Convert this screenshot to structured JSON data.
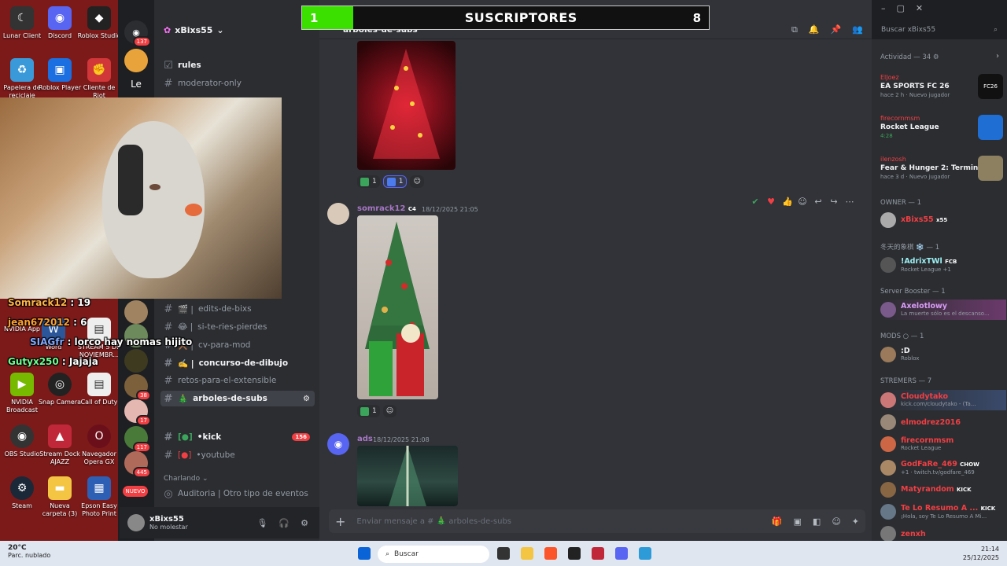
{
  "desktop": {
    "icons": [
      "Lunar Client",
      "Discord",
      "Roblox Studio",
      "Papelera de reciclaje",
      "Roblox Player",
      "Cliente de Riot",
      "Games",
      "Word",
      "STREAM 5 DE NOVIEMBR...",
      "NVIDIA App",
      "NVIDIA Broadcast",
      "Snap Camera",
      "Call of Duty",
      "OBS Studio",
      "Stream Dock AJAZZ",
      "Navegador Opera GX",
      "Steam",
      "Nueva carpeta (3)",
      "Epson Easy Photo Print"
    ]
  },
  "subs_bar": {
    "current": "1",
    "label": "SUSCRIPTORES",
    "goal": "8",
    "progress": 0.125,
    "fill_color": "#3be000"
  },
  "overlay_chat": [
    {
      "user": "Somrack12",
      "text": "19",
      "color": "#ffb347"
    },
    {
      "user": "jean672012",
      "text": "6",
      "color": "#ff9f2e"
    },
    {
      "user": "SIAGfr",
      "text": "lorco hay nomas hijito",
      "color": "#7fa8ff"
    },
    {
      "user": "Gutyx250",
      "text": "Jajaja",
      "color": "#6cff8f"
    }
  ],
  "servers": {
    "badges": [
      "137",
      "51",
      "38",
      "17",
      "117",
      "445",
      "NUEVO"
    ],
    "letter": "Le"
  },
  "guild": {
    "name": "xBixs55",
    "channels_top": [
      {
        "name": "rules",
        "bright": true
      },
      {
        "name": "moderator-only",
        "bright": false
      }
    ],
    "channels": [
      {
        "name": "edits-de-bixs",
        "emoji": "🎬 |",
        "bright": false
      },
      {
        "name": "si-te-ries-pierdes",
        "emoji": "😂 |",
        "bright": false
      },
      {
        "name": "cv-para-mod",
        "emoji": "⚒️ |",
        "bright": false
      },
      {
        "name": "concurso-de-dibujo",
        "emoji": "✍️ |",
        "bright": true
      },
      {
        "name": "retos-para-el-extensible",
        "emoji": "",
        "bright": false
      },
      {
        "name": "arboles-de-subs",
        "emoji": "🎄",
        "bright": true,
        "active": true
      }
    ],
    "kick_channel": {
      "name": "•kick",
      "count": "156"
    },
    "youtube_channel": {
      "name": "•youtube"
    },
    "category": "Charlando",
    "voice_channel": "Auditoria | Otro tipo de eventos"
  },
  "user": {
    "name": "xBixs55",
    "status": "No molestar"
  },
  "main": {
    "channel_title": "arboles-de-subs",
    "search_placeholder": "Buscar xBixs55",
    "reactions_1": [
      {
        "count": "1",
        "color": "#3ba55c"
      },
      {
        "count": "1",
        "color": "#4b7bec"
      }
    ],
    "message2": {
      "author": "somrack12",
      "tag": "C4",
      "time": "18/12/2025 21:05",
      "color": "#a676c4"
    },
    "reactions_2": [
      {
        "count": "1",
        "color": "#3ba55c"
      }
    ],
    "message3": {
      "author": "ads",
      "time": "18/12/2025 21:08",
      "color": "#a676c4"
    },
    "composer_placeholder": "Enviar mensaje a # 🎄 arboles-de-subs"
  },
  "members": {
    "activity_header": "Actividad — 34",
    "activities": [
      {
        "user": "ElJoez",
        "game": "EA SPORTS FC 26",
        "time": "hace 2 h",
        "extra": "Nuevo jugador",
        "thumb_color": "#111"
      },
      {
        "user": "firecornmsm",
        "game": "Rocket League",
        "time": "4:28",
        "extra": "",
        "thumb_color": "#1f6ed4"
      },
      {
        "user": "ilenzosh",
        "game": "Fear & Hunger 2: Termina",
        "time": "hace 3 d",
        "extra": "Nuevo jugador",
        "thumb_color": "#8c8060"
      }
    ],
    "sections": [
      {
        "title": "OWNER — 1",
        "members": [
          {
            "name": "xBixs55",
            "sub": "",
            "tag": "x55",
            "color": "#f23f43"
          }
        ]
      },
      {
        "title": "冬天的象棋 ❄️ — 1",
        "members": [
          {
            "name": "!AdrixTWl",
            "sub": "Rocket League +1",
            "tag": "FCB",
            "color": "#9cf0f4"
          }
        ]
      },
      {
        "title": "Server Booster — 1",
        "members": [
          {
            "name": "Axelotlowy",
            "sub": "La muerte sólo es el descanso...",
            "tag": "",
            "color": "#d89cf6"
          }
        ]
      },
      {
        "title": "MODS ○ — 1",
        "members": [
          {
            "name": ":D",
            "sub": "Roblox",
            "tag": "",
            "color": "#f2f3f5"
          }
        ]
      },
      {
        "title": "STREMERS — 7",
        "members": [
          {
            "name": "Cloudytako",
            "sub": "kick.com/cloudytako - (Ta...",
            "tag": "",
            "color": "#f23f43"
          },
          {
            "name": "elmodrez2016",
            "sub": "",
            "tag": "",
            "color": "#f23f43"
          },
          {
            "name": "firecornmsm",
            "sub": "Rocket League",
            "tag": "",
            "color": "#f23f43"
          },
          {
            "name": "GodFaRe_469",
            "sub": "+1 · twitch.tv/godfare_469",
            "tag": "CHOW",
            "color": "#f23f43"
          },
          {
            "name": "Matyrandom",
            "sub": "",
            "tag": "KICK",
            "color": "#f23f43"
          },
          {
            "name": "Te Lo Resumo A ...",
            "sub": "¡Hola, soy Te Lo Resumo A Mi...",
            "tag": "KICK",
            "color": "#f23f43"
          },
          {
            "name": "zenxh",
            "sub": "",
            "tag": "",
            "color": "#f23f43"
          }
        ]
      }
    ]
  },
  "taskbar": {
    "temp": "20°C",
    "weather": "Parc. nublado",
    "search": "Buscar",
    "time": "21:14",
    "date": "25/12/2025"
  }
}
